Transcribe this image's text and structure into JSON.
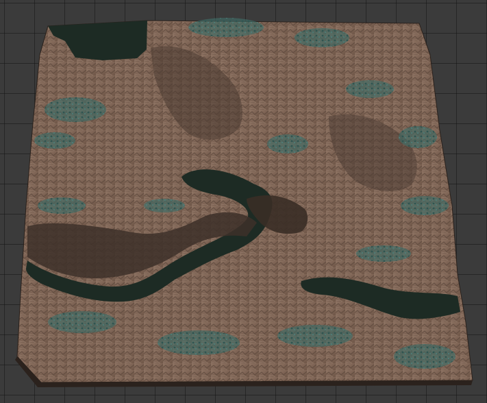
{
  "viewport": {
    "background_color": "#3b3b3b",
    "grid_line_color": "#1e1e1e"
  },
  "terrain": {
    "rock_color_light": "#a08674",
    "rock_color_mid": "#7a6253",
    "rock_color_dark": "#3d3029",
    "vegetation_color": "#3f6b66",
    "water_color": "#1d2b24"
  }
}
